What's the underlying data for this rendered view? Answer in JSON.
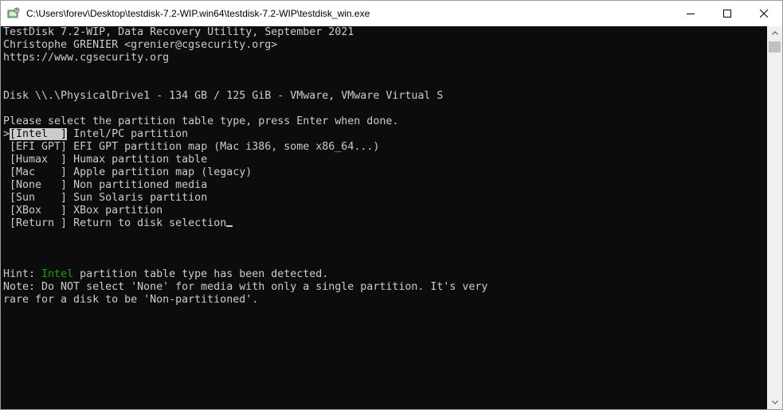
{
  "window": {
    "title": "C:\\Users\\forev\\Desktop\\testdisk-7.2-WIP.win64\\testdisk-7.2-WIP\\testdisk_win.exe"
  },
  "terminal": {
    "header": [
      "TestDisk 7.2-WIP, Data Recovery Utility, September 2021",
      "Christophe GRENIER <grenier@cgsecurity.org>",
      "https://www.cgsecurity.org"
    ],
    "disk": "Disk \\\\.\\PhysicalDrive1 - 134 GB / 125 GiB - VMware, VMware Virtual S",
    "prompt": "Please select the partition table type, press Enter when done.",
    "options": [
      {
        "marker": ">",
        "key": "[Intel  ]",
        "desc": " Intel/PC partition",
        "selected": true
      },
      {
        "marker": " ",
        "key": "[EFI GPT]",
        "desc": " EFI GPT partition map (Mac i386, some x86_64...)",
        "selected": false
      },
      {
        "marker": " ",
        "key": "[Humax  ]",
        "desc": " Humax partition table",
        "selected": false
      },
      {
        "marker": " ",
        "key": "[Mac    ]",
        "desc": " Apple partition map (legacy)",
        "selected": false
      },
      {
        "marker": " ",
        "key": "[None   ]",
        "desc": " Non partitioned media",
        "selected": false
      },
      {
        "marker": " ",
        "key": "[Sun    ]",
        "desc": " Sun Solaris partition",
        "selected": false
      },
      {
        "marker": " ",
        "key": "[XBox   ]",
        "desc": " XBox partition",
        "selected": false
      },
      {
        "marker": " ",
        "key": "[Return ]",
        "desc": " Return to disk selection",
        "selected": false
      }
    ],
    "hint_prefix": "Hint: ",
    "hint_highlight": "Intel",
    "hint_suffix": " partition table type has been detected.",
    "note_line1": "Note: Do NOT select 'None' for media with only a single partition. It's very",
    "note_line2": "rare for a disk to be 'Non-partitioned'."
  },
  "colors": {
    "background": "#0c0c0c",
    "foreground": "#cccccc",
    "highlight_green": "#13a10e"
  },
  "icons": {
    "app": "testdisk-app-icon",
    "minimize": "minimize-icon",
    "maximize": "maximize-icon",
    "close": "close-icon"
  }
}
